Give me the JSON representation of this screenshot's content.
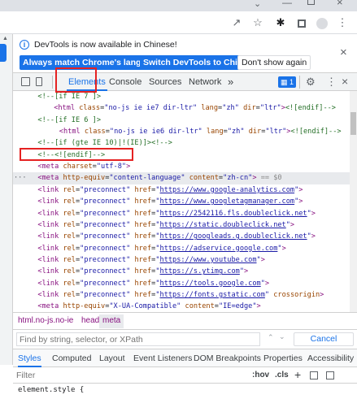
{
  "browser": {
    "icons": [
      "share-icon",
      "star-icon",
      "extensions-icon",
      "tab-search-icon",
      "profile-icon",
      "more-icon"
    ]
  },
  "notice": {
    "text": "DevTools is now available in Chinese!",
    "btn_match": "Always match Chrome's language",
    "btn_switch": "Switch DevTools to Chinese",
    "btn_dont": "Don't show again",
    "close": "×"
  },
  "tabs": {
    "elements": "Elements",
    "console": "Console",
    "sources": "Sources",
    "network": "Network",
    "more": "»",
    "badge": "1"
  },
  "code_lines": [
    {
      "indent": 4,
      "parts": [
        [
          "com",
          "<!--[if IE 7 ]>"
        ]
      ]
    },
    {
      "indent": 7,
      "parts": [
        [
          "tag",
          "<html "
        ],
        [
          "attr",
          "class"
        ],
        [
          "txt",
          "="
        ],
        [
          "val",
          "\"no-js ie ie7 dir-ltr\""
        ],
        [
          "txt",
          " "
        ],
        [
          "attr",
          "lang"
        ],
        [
          "txt",
          "="
        ],
        [
          "val",
          "\"zh\""
        ],
        [
          "txt",
          " "
        ],
        [
          "attr",
          "dir"
        ],
        [
          "txt",
          "="
        ],
        [
          "val",
          "\"ltr\""
        ],
        [
          "tag",
          ">"
        ],
        [
          "com",
          "<![endif]-->"
        ]
      ]
    },
    {
      "indent": 4,
      "parts": [
        [
          "com",
          "<!--[if IE 6 ]>"
        ]
      ]
    },
    {
      "indent": 8,
      "parts": [
        [
          "tag",
          "<html "
        ],
        [
          "attr",
          "class"
        ],
        [
          "txt",
          "="
        ],
        [
          "val",
          "\"no-js ie ie6 dir-ltr\""
        ],
        [
          "txt",
          " "
        ],
        [
          "attr",
          "lang"
        ],
        [
          "txt",
          "="
        ],
        [
          "val",
          "\"zh\""
        ],
        [
          "txt",
          " "
        ],
        [
          "attr",
          "dir"
        ],
        [
          "txt",
          "="
        ],
        [
          "val",
          "\"ltr\""
        ],
        [
          "tag",
          ">"
        ],
        [
          "com",
          "<![endif]-->"
        ]
      ]
    },
    {
      "indent": 4,
      "parts": [
        [
          "com",
          "<!--[if (gte IE 10)|!(IE)]><!-->"
        ]
      ]
    },
    {
      "indent": 4,
      "parts": [
        [
          "com",
          "<!--<![endif]-->"
        ]
      ]
    },
    {
      "indent": 4,
      "parts": [
        [
          "tag",
          "<meta "
        ],
        [
          "attr",
          "charset"
        ],
        [
          "txt",
          "="
        ],
        [
          "val",
          "\"utf-8\""
        ],
        [
          "tag",
          ">"
        ]
      ]
    },
    {
      "indent": 4,
      "selected": true,
      "parts": [
        [
          "tag",
          "<meta "
        ],
        [
          "attr",
          "http-equiv"
        ],
        [
          "txt",
          "="
        ],
        [
          "val",
          "\"content-language\""
        ],
        [
          "txt",
          " "
        ],
        [
          "attr",
          "content"
        ],
        [
          "txt",
          "="
        ],
        [
          "val",
          "\"zh-cn\""
        ],
        [
          "tag",
          ">"
        ],
        [
          "grey",
          " == $0"
        ]
      ]
    },
    {
      "indent": 4,
      "parts": [
        [
          "tag",
          "<link "
        ],
        [
          "attr",
          "rel"
        ],
        [
          "txt",
          "="
        ],
        [
          "val",
          "\"preconnect\""
        ],
        [
          "txt",
          " "
        ],
        [
          "attr",
          "href"
        ],
        [
          "txt",
          "="
        ],
        [
          "val",
          "\""
        ],
        [
          "link",
          "https://www.google-analytics.com"
        ],
        [
          "val",
          "\""
        ],
        [
          "tag",
          ">"
        ]
      ]
    },
    {
      "indent": 4,
      "parts": [
        [
          "tag",
          "<link "
        ],
        [
          "attr",
          "rel"
        ],
        [
          "txt",
          "="
        ],
        [
          "val",
          "\"preconnect\""
        ],
        [
          "txt",
          " "
        ],
        [
          "attr",
          "href"
        ],
        [
          "txt",
          "="
        ],
        [
          "val",
          "\""
        ],
        [
          "link",
          "https://www.googletagmanager.com"
        ],
        [
          "val",
          "\""
        ],
        [
          "tag",
          ">"
        ]
      ]
    },
    {
      "indent": 4,
      "parts": [
        [
          "tag",
          "<link "
        ],
        [
          "attr",
          "rel"
        ],
        [
          "txt",
          "="
        ],
        [
          "val",
          "\"preconnect\""
        ],
        [
          "txt",
          " "
        ],
        [
          "attr",
          "href"
        ],
        [
          "txt",
          "="
        ],
        [
          "val",
          "\""
        ],
        [
          "link",
          "https://2542116.fls.doubleclick.net"
        ],
        [
          "val",
          "\""
        ],
        [
          "tag",
          ">"
        ]
      ]
    },
    {
      "indent": 4,
      "parts": [
        [
          "tag",
          "<link "
        ],
        [
          "attr",
          "rel"
        ],
        [
          "txt",
          "="
        ],
        [
          "val",
          "\"preconnect\""
        ],
        [
          "txt",
          " "
        ],
        [
          "attr",
          "href"
        ],
        [
          "txt",
          "="
        ],
        [
          "val",
          "\""
        ],
        [
          "link",
          "https://static.doubleclick.net"
        ],
        [
          "val",
          "\""
        ],
        [
          "tag",
          ">"
        ]
      ]
    },
    {
      "indent": 4,
      "parts": [
        [
          "tag",
          "<link "
        ],
        [
          "attr",
          "rel"
        ],
        [
          "txt",
          "="
        ],
        [
          "val",
          "\"preconnect\""
        ],
        [
          "txt",
          " "
        ],
        [
          "attr",
          "href"
        ],
        [
          "txt",
          "="
        ],
        [
          "val",
          "\""
        ],
        [
          "link",
          "https://googleads.g.doubleclick.net"
        ],
        [
          "val",
          "\""
        ],
        [
          "tag",
          ">"
        ]
      ]
    },
    {
      "indent": 4,
      "parts": [
        [
          "tag",
          "<link "
        ],
        [
          "attr",
          "rel"
        ],
        [
          "txt",
          "="
        ],
        [
          "val",
          "\"preconnect\""
        ],
        [
          "txt",
          " "
        ],
        [
          "attr",
          "href"
        ],
        [
          "txt",
          "="
        ],
        [
          "val",
          "\""
        ],
        [
          "link",
          "https://adservice.google.com"
        ],
        [
          "val",
          "\""
        ],
        [
          "tag",
          ">"
        ]
      ]
    },
    {
      "indent": 4,
      "parts": [
        [
          "tag",
          "<link "
        ],
        [
          "attr",
          "rel"
        ],
        [
          "txt",
          "="
        ],
        [
          "val",
          "\"preconnect\""
        ],
        [
          "txt",
          " "
        ],
        [
          "attr",
          "href"
        ],
        [
          "txt",
          "="
        ],
        [
          "val",
          "\""
        ],
        [
          "link",
          "https://www.youtube.com"
        ],
        [
          "val",
          "\""
        ],
        [
          "tag",
          ">"
        ]
      ]
    },
    {
      "indent": 4,
      "parts": [
        [
          "tag",
          "<link "
        ],
        [
          "attr",
          "rel"
        ],
        [
          "txt",
          "="
        ],
        [
          "val",
          "\"preconnect\""
        ],
        [
          "txt",
          " "
        ],
        [
          "attr",
          "href"
        ],
        [
          "txt",
          "="
        ],
        [
          "val",
          "\""
        ],
        [
          "link",
          "https://s.ytimg.com"
        ],
        [
          "val",
          "\""
        ],
        [
          "tag",
          ">"
        ]
      ]
    },
    {
      "indent": 4,
      "parts": [
        [
          "tag",
          "<link "
        ],
        [
          "attr",
          "rel"
        ],
        [
          "txt",
          "="
        ],
        [
          "val",
          "\"preconnect\""
        ],
        [
          "txt",
          " "
        ],
        [
          "attr",
          "href"
        ],
        [
          "txt",
          "="
        ],
        [
          "val",
          "\""
        ],
        [
          "link",
          "https://tools.google.com"
        ],
        [
          "val",
          "\""
        ],
        [
          "tag",
          ">"
        ]
      ]
    },
    {
      "indent": 4,
      "parts": [
        [
          "tag",
          "<link "
        ],
        [
          "attr",
          "rel"
        ],
        [
          "txt",
          "="
        ],
        [
          "val",
          "\"preconnect\""
        ],
        [
          "txt",
          " "
        ],
        [
          "attr",
          "href"
        ],
        [
          "txt",
          "="
        ],
        [
          "val",
          "\""
        ],
        [
          "link",
          "https://fonts.gstatic.com"
        ],
        [
          "val",
          "\""
        ],
        [
          "txt",
          " "
        ],
        [
          "attr",
          "crossorigin"
        ],
        [
          "tag",
          ">"
        ]
      ]
    },
    {
      "indent": 4,
      "parts": [
        [
          "tag",
          "<meta "
        ],
        [
          "attr",
          "http-equiv"
        ],
        [
          "txt",
          "="
        ],
        [
          "val",
          "\"X-UA-Compatible\""
        ],
        [
          "txt",
          " "
        ],
        [
          "attr",
          "content"
        ],
        [
          "txt",
          "="
        ],
        [
          "val",
          "\"IE=edge\""
        ],
        [
          "tag",
          ">"
        ]
      ]
    }
  ],
  "crumbs": {
    "html": "html.no-js.no-ie",
    "head": "head",
    "meta": "meta"
  },
  "find": {
    "placeholder": "Find by string, selector, or XPath",
    "cancel": "Cancel"
  },
  "style_tabs": [
    "Styles",
    "Computed",
    "Layout",
    "Event Listeners",
    "DOM Breakpoints",
    "Properties",
    "Accessibility"
  ],
  "filter": {
    "placeholder": "Filter",
    "hov": ":hov",
    "cls": ".cls",
    "plus": "+"
  },
  "element_style": "element.style {"
}
